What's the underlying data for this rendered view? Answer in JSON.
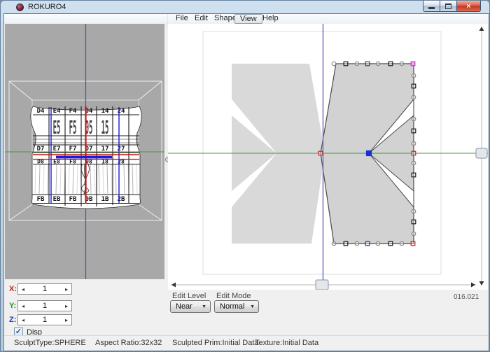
{
  "window": {
    "title": "ROKURO4"
  },
  "menu": {
    "items": [
      "File",
      "Edit",
      "Shape",
      "View",
      "Help"
    ],
    "active_index": 3
  },
  "preview3d": {
    "texture_rows": {
      "row1": [
        "D4",
        "E4",
        "F4",
        "04",
        "14",
        "24"
      ],
      "row2": [
        "E5",
        "F5",
        "05",
        "15"
      ],
      "row3": [
        "D7",
        "E7",
        "F7",
        "07",
        "17",
        "27"
      ],
      "row4": [
        "D8",
        "E8",
        "F8",
        "08",
        "18",
        "28"
      ],
      "row5": [
        "FB",
        "EB",
        "FB",
        "0B",
        "1B",
        "2B"
      ]
    }
  },
  "axis_spinners": [
    {
      "label": "X:",
      "value": "1",
      "color": "#c22222"
    },
    {
      "label": "Y:",
      "value": "1",
      "color": "#2f8f2f"
    },
    {
      "label": "Z:",
      "value": "1",
      "color": "#2a3ec2"
    }
  ],
  "disp_frame": {
    "label": "Disp Frame",
    "checked": true,
    "check_glyph": "✓"
  },
  "edit_level": {
    "label": "Edit Level",
    "value": "Near"
  },
  "edit_mode": {
    "label": "Edit Mode",
    "value": "Normal"
  },
  "coords_readout": "016.021",
  "statusbar": {
    "items": [
      "SculptType:SPHERE",
      "Aspect Ratio:32x32",
      "Sculpted Prim:Initial Data",
      "Texture:Initial Data"
    ]
  },
  "colors": {
    "guide_green": "#3f9b3f",
    "guide_blue": "#7b7bd0",
    "preview_axis_blue": "#4d4da8",
    "texture_red": "#c41414",
    "texture_blue": "#1b1bd8",
    "shape_fill": "#d2d2d2",
    "silhouette_fill": "#d9d9d9",
    "point_gray": "#8a8a8a",
    "point_black": "#1a1a1a",
    "point_red": "#cc2020",
    "point_blue": "#2233cc",
    "point_magenta": "#c23ac2",
    "point_selected_fill": "#1530d8"
  }
}
